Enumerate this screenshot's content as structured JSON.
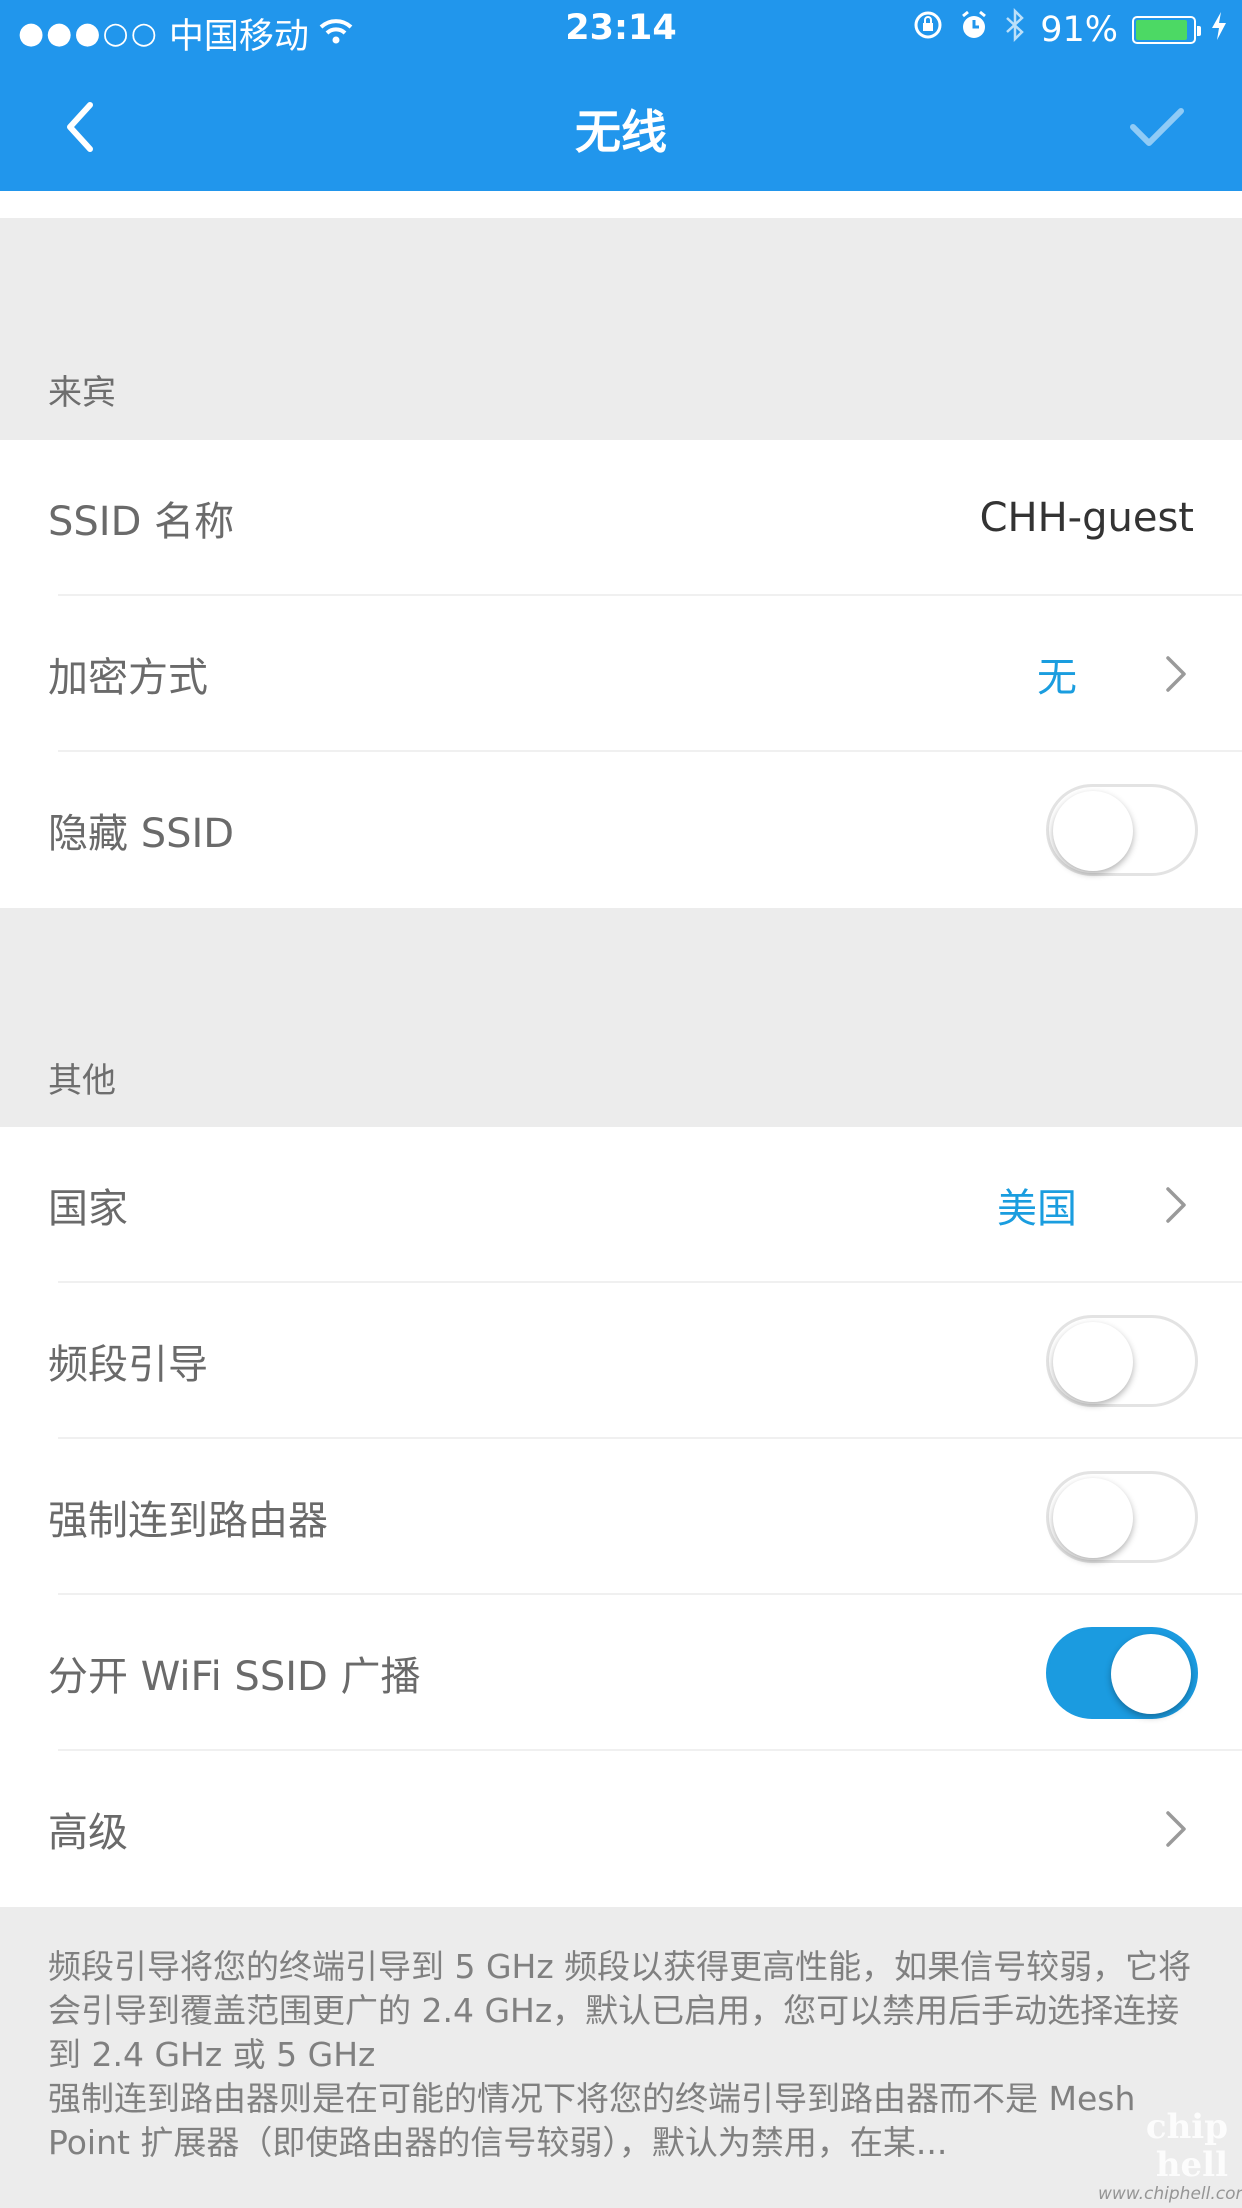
{
  "status_bar": {
    "signal_dots": "●●●○○",
    "carrier": "中国移动",
    "time": "23:14",
    "battery_percent": "91%",
    "battery_level": 0.91
  },
  "header": {
    "title": "无线",
    "back_icon": "chevron-left-icon",
    "confirm_icon": "check-icon"
  },
  "guest_section": {
    "label": "来宾",
    "rows": [
      {
        "label": "SSID 名称",
        "value": "CHH-guest"
      },
      {
        "label": "加密方式",
        "value": "无"
      },
      {
        "label": "隐藏 SSID",
        "toggle_on": false
      }
    ]
  },
  "other_section": {
    "label": "其他",
    "rows": [
      {
        "label": "国家",
        "value": "美国"
      },
      {
        "label": "频段引导",
        "toggle_on": false
      },
      {
        "label": "强制连到路由器",
        "toggle_on": false
      },
      {
        "label": "分开 WiFi SSID 广播",
        "toggle_on": true
      },
      {
        "label": "高级"
      }
    ]
  },
  "footer_note": {
    "line1": "频段引导将您的终端引导到 5 GHz 频段以获得更高性能，如果信号较弱，它将会引导到覆盖范围更广的 2.4 GHz，默认已启用，您可以禁用后手动选择连接到 2.4 GHz 或 5 GHz",
    "line2": "强制连到路由器则是在可能的情况下将您的终端引导到路由器而不是 Mesh Point 扩展器（即使路由器的信号较弱），默认为禁用，在某..."
  },
  "watermark": {
    "mark": "chip hell",
    "site": "www.chiphell.com"
  },
  "colors": {
    "header_bg": "#2196ec",
    "accent": "#1a9ddf",
    "toggle_on": "#1b9be0",
    "page_bg": "#ececec"
  }
}
